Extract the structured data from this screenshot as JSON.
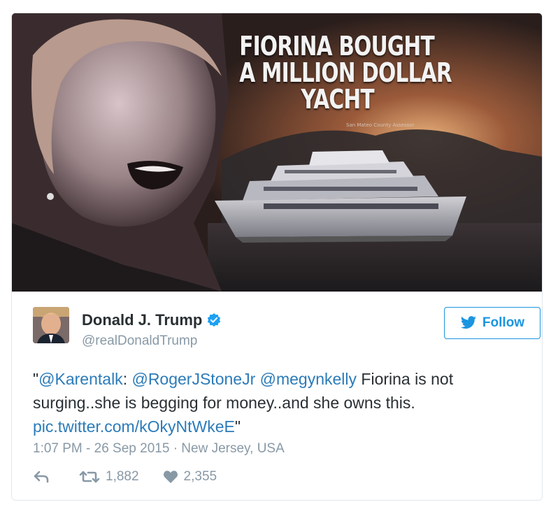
{
  "media": {
    "headline_line1": "FIORINA BOUGHT",
    "headline_line2": "A MILLION DOLLAR",
    "headline_line3": "YACHT",
    "credit": "San Mateo County Assessor"
  },
  "author": {
    "name": "Donald J. Trump",
    "handle": "@realDonaldTrump",
    "verified": true,
    "avatar_icon": "profile-photo"
  },
  "follow_button": {
    "label": "Follow",
    "icon": "twitter-bird-icon"
  },
  "tweet": {
    "quote_open": "\"",
    "mention1": "@Karentalk",
    "sep1": ": ",
    "mention2": "@RogerJStoneJr",
    "sep2": " ",
    "mention3": "@megynkelly",
    "body": " Fiorina is not surging..she is begging for money..and she owns this. ",
    "link": "pic.twitter.com/kOkyNtWkeE",
    "quote_close": "\""
  },
  "meta": {
    "timestamp": "1:07 PM - 26 Sep 2015 · New Jersey, USA"
  },
  "actions": {
    "reply_icon": "reply-icon",
    "retweet_icon": "retweet-icon",
    "retweet_count": "1,882",
    "like_icon": "heart-icon",
    "like_count": "2,355"
  },
  "colors": {
    "link": "#2b7bb9",
    "accent": "#1b95e0",
    "muted": "#8899a6",
    "text": "#292f33"
  }
}
